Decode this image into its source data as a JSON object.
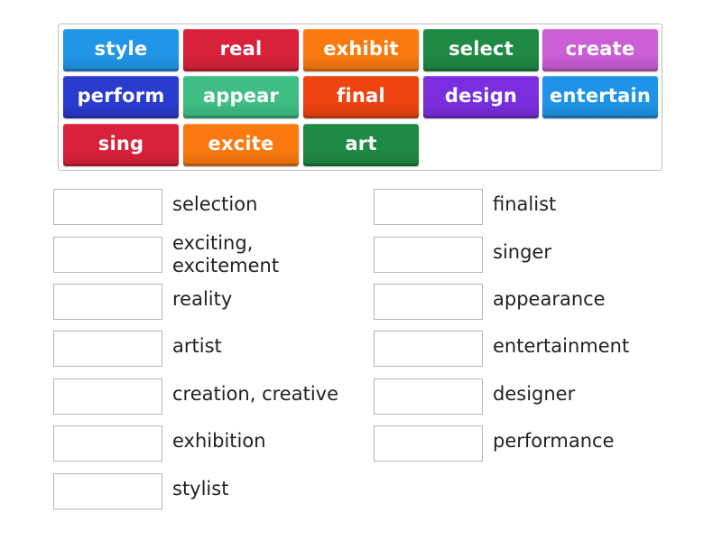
{
  "activity": "match-up",
  "tiles": [
    {
      "label": "style",
      "color": "#2196e6"
    },
    {
      "label": "real",
      "color": "#d9223a"
    },
    {
      "label": "exhibit",
      "color": "#fb7a0f"
    },
    {
      "label": "select",
      "color": "#1f8a45"
    },
    {
      "label": "create",
      "color": "#cc5ed6"
    },
    {
      "label": "perform",
      "color": "#2a3bd0"
    },
    {
      "label": "appear",
      "color": "#3fbf86"
    },
    {
      "label": "final",
      "color": "#ee4410"
    },
    {
      "label": "design",
      "color": "#7a2ee0"
    },
    {
      "label": "entertain",
      "color": "#1e94e8"
    },
    {
      "label": "sing",
      "color": "#d9223a"
    },
    {
      "label": "excite",
      "color": "#fb7a0f"
    },
    {
      "label": "art",
      "color": "#1f8a45"
    }
  ],
  "targets_left": [
    {
      "label": "selection",
      "answer": ""
    },
    {
      "label": "exciting,\nexcitement",
      "answer": ""
    },
    {
      "label": "reality",
      "answer": ""
    },
    {
      "label": "artist",
      "answer": ""
    },
    {
      "label": "creation, creative",
      "answer": ""
    },
    {
      "label": "exhibition",
      "answer": ""
    },
    {
      "label": "stylist",
      "answer": ""
    }
  ],
  "targets_right": [
    {
      "label": "finalist",
      "answer": ""
    },
    {
      "label": "singer",
      "answer": ""
    },
    {
      "label": "appearance",
      "answer": ""
    },
    {
      "label": "entertainment",
      "answer": ""
    },
    {
      "label": "designer",
      "answer": ""
    },
    {
      "label": "performance",
      "answer": ""
    }
  ]
}
